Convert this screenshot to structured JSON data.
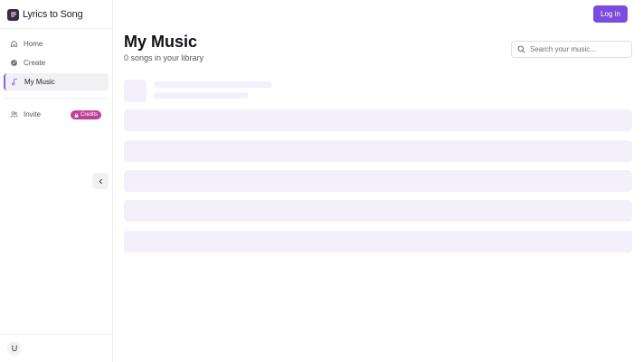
{
  "brand": {
    "name": "Lyrics to Song"
  },
  "sidebar": {
    "items": [
      {
        "label": "Home",
        "icon": "home-icon"
      },
      {
        "label": "Create",
        "icon": "create-icon"
      },
      {
        "label": "My Music",
        "icon": "music-note-icon",
        "active": true
      },
      {
        "label": "Invite",
        "icon": "users-icon"
      }
    ],
    "credits_badge": "Credits",
    "collapse_icon": "chevron-left-icon",
    "avatar_initial": "U"
  },
  "header": {
    "login_label": "Log in"
  },
  "main": {
    "title": "My Music",
    "subtitle": "0 songs in your library",
    "search": {
      "placeholder": "Search your music..."
    }
  },
  "colors": {
    "accent": "#7c4ddd",
    "badge": "#c2409a",
    "skeleton": "#f3f0fc",
    "active_border": "#8b5cf6"
  }
}
